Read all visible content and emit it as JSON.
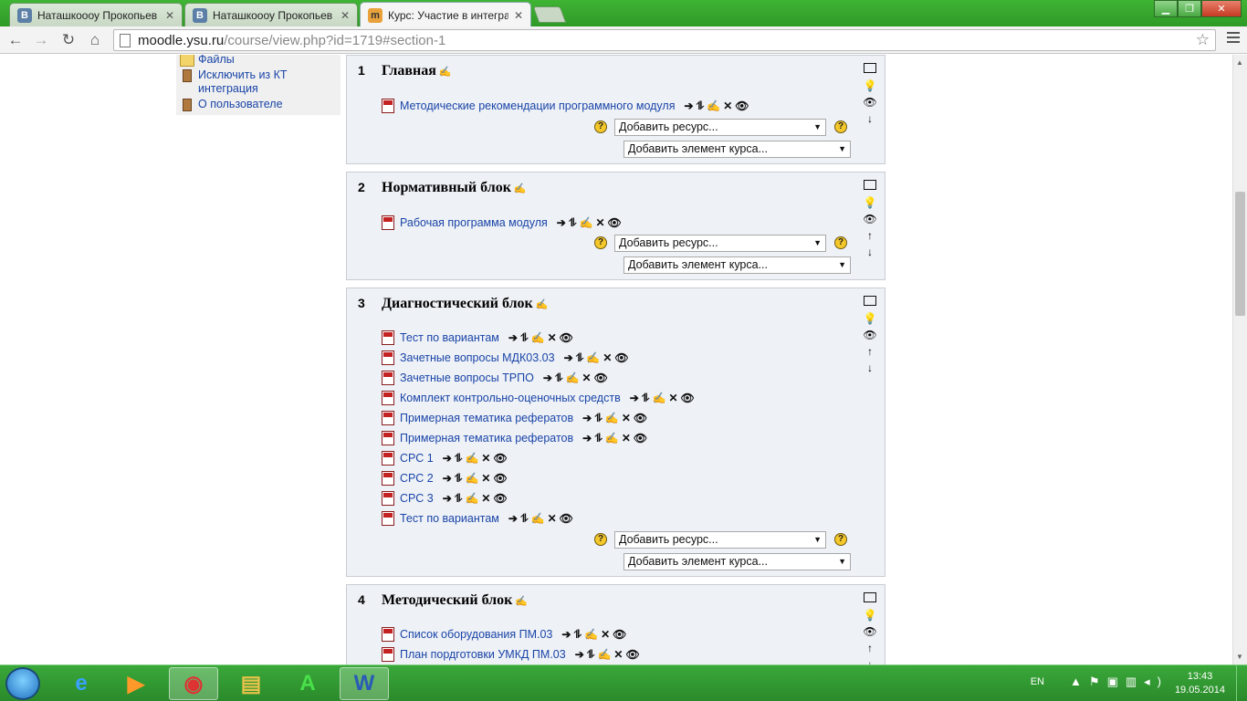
{
  "browser": {
    "tabs": [
      {
        "favicon": "В",
        "title": "Наташкоооу Прокопьев"
      },
      {
        "favicon": "В",
        "title": "Наташкоооу Прокопьев"
      },
      {
        "favicon": "m",
        "title": "Курс: Участие в интеграц"
      }
    ],
    "url_host": "moodle.ysu.ru",
    "url_path": "/course/view.php?id=1719#section-1"
  },
  "sidebar": {
    "items": [
      {
        "icon": "folder-icon",
        "label": "Файлы"
      },
      {
        "icon": "door-icon",
        "label": "Исключить из КТ интеграция"
      },
      {
        "icon": "door-icon",
        "label": "О пользователе"
      }
    ]
  },
  "controls": {
    "add_resource": "Добавить ресурс...",
    "add_activity": "Добавить элемент курса...",
    "help": "?",
    "activity_actions": "➔⥮✍✕👁"
  },
  "sections": [
    {
      "number": "1",
      "title": "Главная",
      "activities": [
        "Методические рекомендации программного модуля"
      ]
    },
    {
      "number": "2",
      "title": "Нормативный блок",
      "activities": [
        "Рабочая программа модуля"
      ]
    },
    {
      "number": "3",
      "title": "Диагностический блок",
      "activities": [
        "Тест по вариантам",
        "Зачетные вопросы МДК03.03",
        "Зачетные вопросы ТРПО",
        "Комплект контрольно-оценочных средств",
        "Примерная тематика рефератов",
        "Примерная тематика рефератов",
        "СРС 1",
        "СРС 2",
        "СРС 3",
        "Тест по вариантам"
      ]
    },
    {
      "number": "4",
      "title": "Методический блок",
      "activities": [
        "Список оборудования ПМ.03",
        "План пордготовки УМКД ПМ.03"
      ]
    }
  ],
  "taskbar": {
    "language": "EN",
    "time": "13:43",
    "date": "19.05.2014"
  }
}
